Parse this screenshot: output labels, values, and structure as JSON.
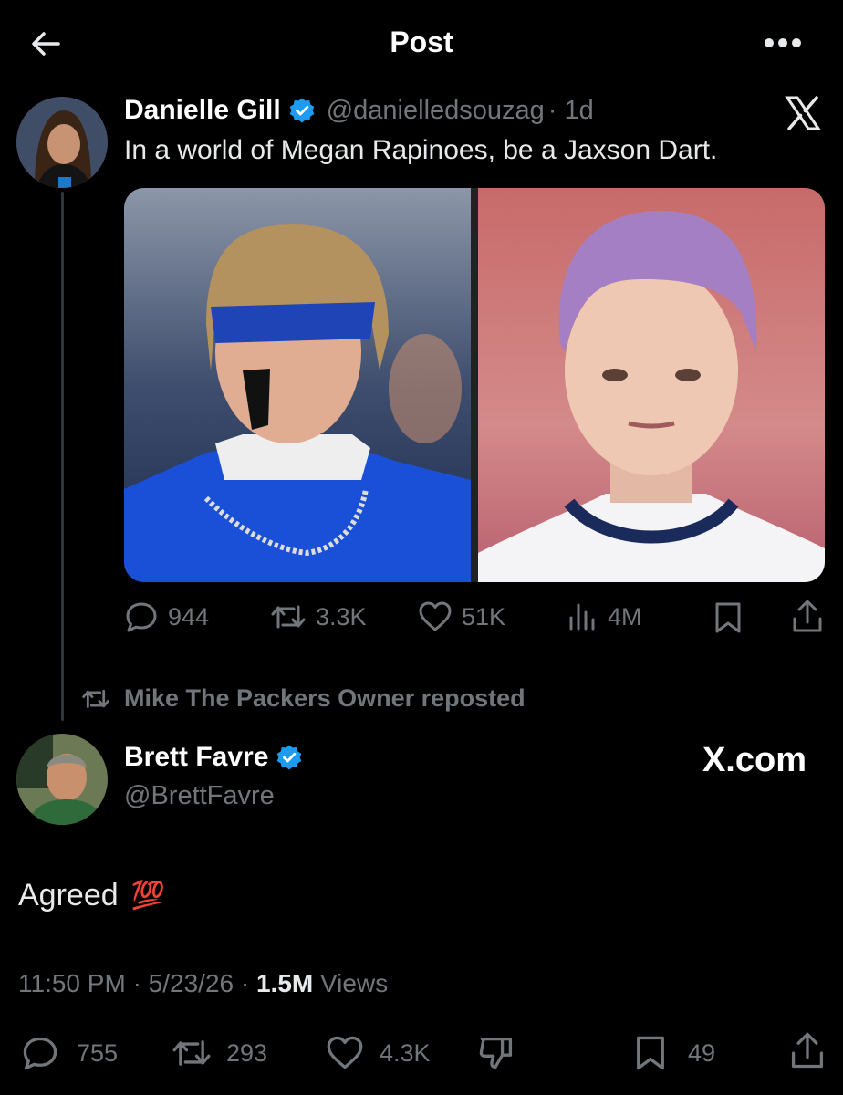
{
  "header": {
    "title": "Post"
  },
  "original_post": {
    "author_name": "Danielle Gill",
    "handle": "@danielledsouzag",
    "time": "· 1d",
    "text": "In a world of Megan Rapinoes, be a Jaxson Dart.",
    "stats": {
      "replies": "944",
      "reposts": "3.3K",
      "likes": "51K",
      "views": "4M"
    }
  },
  "repost_notice": "Mike The Packers Owner reposted",
  "main_post": {
    "author_name": "Brett Favre",
    "handle": "@BrettFavre",
    "text": "Agreed",
    "emoji": "💯",
    "watermark": "X.com",
    "time": "11:50 PM",
    "date": "5/23/26",
    "views_count": "1.5M",
    "views_label": "Views",
    "stats": {
      "replies": "755",
      "reposts": "293",
      "likes": "4.3K",
      "bookmarks": "49"
    }
  },
  "colors": {
    "background": "#000000",
    "verified": "#1d9bf0",
    "muted": "#71767b"
  }
}
